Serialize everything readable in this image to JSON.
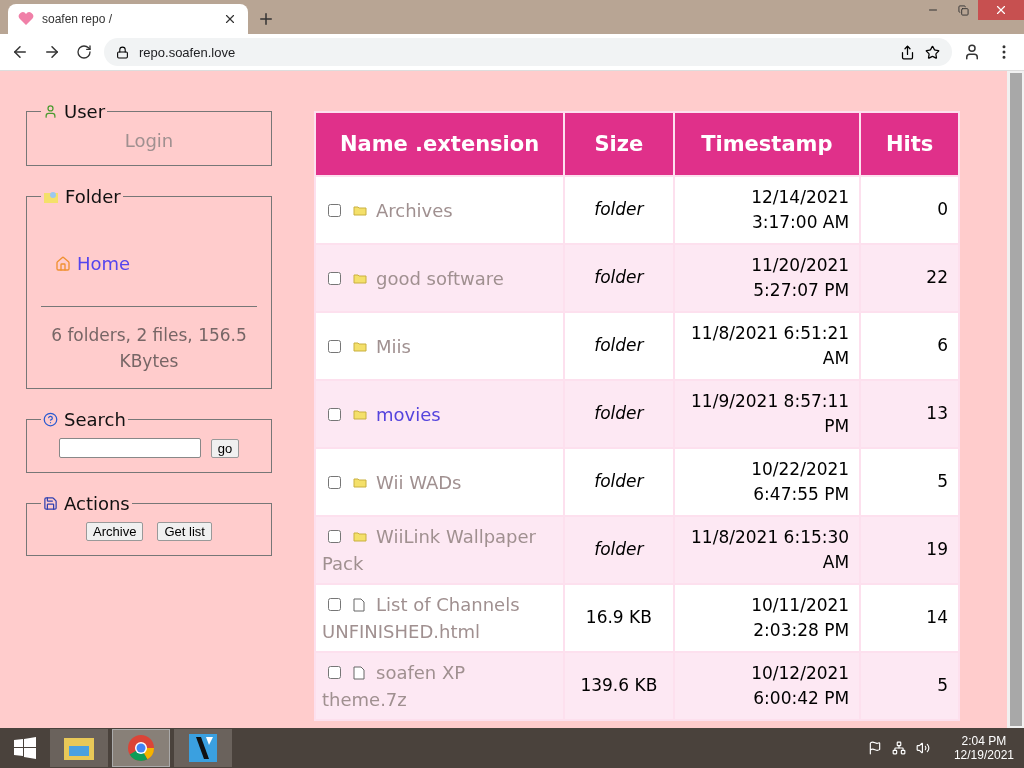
{
  "browser": {
    "tab_title": "soafen repo /",
    "address": "repo.soafen.love"
  },
  "sidebar": {
    "user": {
      "legend": "User",
      "link": "Login"
    },
    "folder": {
      "legend": "Folder",
      "home": "Home",
      "stats": "6 folders, 2 files, 156.5 KBytes"
    },
    "search": {
      "legend": "Search",
      "button": "go"
    },
    "actions": {
      "legend": "Actions",
      "buttons": [
        "Archive",
        "Get list"
      ]
    }
  },
  "table": {
    "columns": [
      "Name .extension",
      "Size",
      "Timestamp",
      "Hits"
    ],
    "rows": [
      {
        "kind": "folder",
        "name": "Archives",
        "visited": true,
        "checked": false,
        "size": "folder",
        "timestamp": "12/14/2021 3:17:00 AM",
        "hits": "0"
      },
      {
        "kind": "folder",
        "name": "good software",
        "visited": true,
        "checked": false,
        "size": "folder",
        "timestamp": "11/20/2021 5:27:07 PM",
        "hits": "22"
      },
      {
        "kind": "folder",
        "name": "Miis",
        "visited": true,
        "checked": false,
        "size": "folder",
        "timestamp": "11/8/2021 6:51:21 AM",
        "hits": "6"
      },
      {
        "kind": "folder",
        "name": "movies",
        "visited": false,
        "checked": false,
        "size": "folder",
        "timestamp": "11/9/2021 8:57:11 PM",
        "hits": "13"
      },
      {
        "kind": "folder",
        "name": "Wii WADs",
        "visited": true,
        "checked": false,
        "size": "folder",
        "timestamp": "10/22/2021 6:47:55 PM",
        "hits": "5"
      },
      {
        "kind": "folder",
        "name": "WiiLink Wallpaper Pack",
        "visited": true,
        "checked": false,
        "size": "folder",
        "timestamp": "11/8/2021 6:15:30 AM",
        "hits": "19"
      },
      {
        "kind": "file",
        "name": "List of Channels UNFINISHED.html",
        "visited": true,
        "checked": false,
        "size": "16.9 KB",
        "timestamp": "10/11/2021 2:03:28 PM",
        "hits": "14"
      },
      {
        "kind": "file",
        "name": "soafen XP theme.7z",
        "visited": true,
        "checked": false,
        "size": "139.6 KB",
        "timestamp": "10/12/2021 6:00:42 PM",
        "hits": "5"
      }
    ]
  },
  "taskbar": {
    "apps": [
      {
        "kind": "explorer",
        "selected": false
      },
      {
        "kind": "browser",
        "selected": true
      },
      {
        "kind": "video",
        "selected": false
      }
    ],
    "time": "2:04 PM",
    "date": "12/19/2021"
  }
}
